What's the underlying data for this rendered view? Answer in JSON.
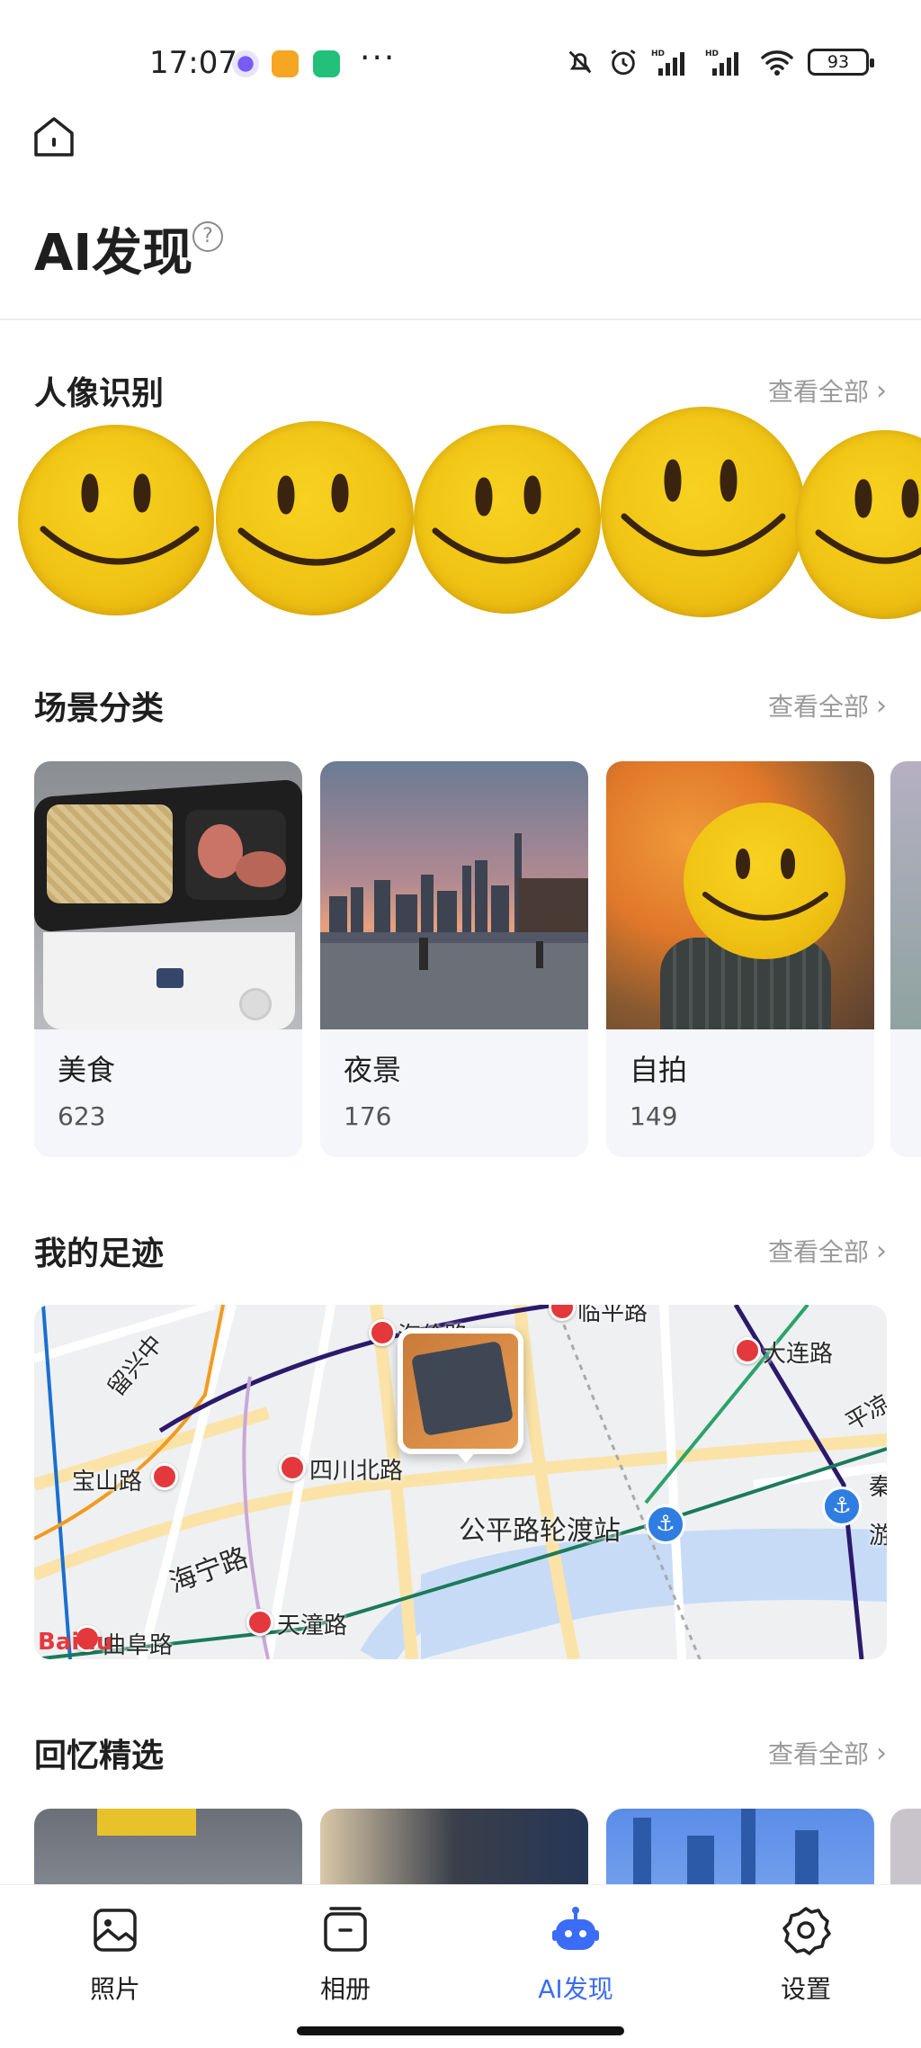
{
  "status_bar": {
    "time": "17:07",
    "more": "···",
    "battery": "93"
  },
  "header": {
    "title": "AI发现",
    "help_icon": "?"
  },
  "sections": {
    "people": {
      "title": "人像识别",
      "see_all": "查看全部"
    },
    "scenes": {
      "title": "场景分类",
      "see_all": "查看全部"
    },
    "footprints": {
      "title": "我的足迹",
      "see_all": "查看全部"
    },
    "memories": {
      "title": "回忆精选",
      "see_all": "查看全部"
    }
  },
  "scenes": [
    {
      "name": "美食",
      "count": "623"
    },
    {
      "name": "夜景",
      "count": "176"
    },
    {
      "name": "自拍",
      "count": "149"
    }
  ],
  "map": {
    "labels": [
      "海伦路",
      "临平路",
      "大连路",
      "宝山路",
      "四川北路",
      "公平路轮渡站",
      "海宁路",
      "天潼路",
      "曲阜路",
      "留兴中",
      "平凉",
      "秦",
      "游"
    ],
    "logo": "Baidu"
  },
  "nav": [
    {
      "label": "照片",
      "icon": "photo-icon"
    },
    {
      "label": "相册",
      "icon": "album-icon"
    },
    {
      "label": "AI发现",
      "icon": "robot-icon"
    },
    {
      "label": "设置",
      "icon": "gear-icon"
    }
  ],
  "colors": {
    "accent": "#3b6cf6",
    "metro": "#e4393c"
  }
}
